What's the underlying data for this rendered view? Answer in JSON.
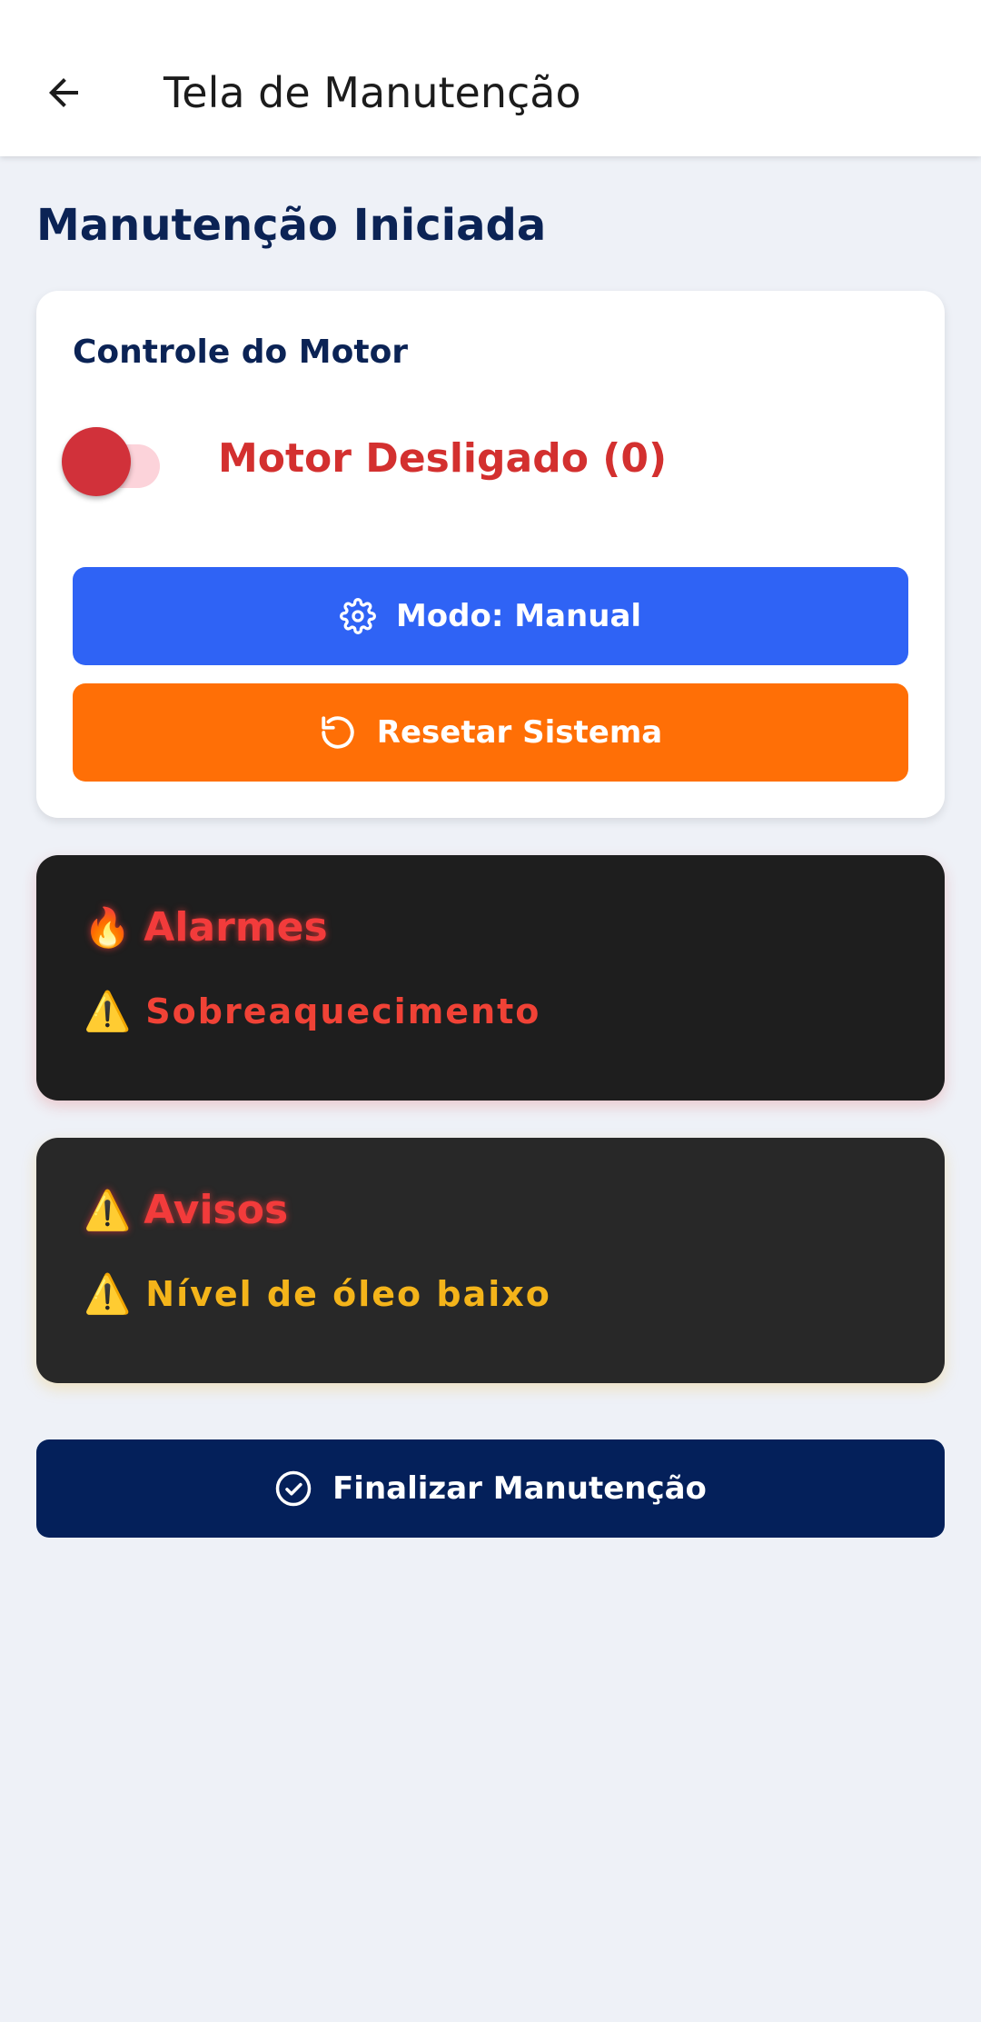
{
  "appbar": {
    "title": "Tela de Manutenção",
    "back_icon": "arrow-left-icon"
  },
  "page_title": "Manutenção Iniciada",
  "motor_card": {
    "title": "Controle do Motor",
    "toggle_on": false,
    "status_text": "Motor Desligado (0)",
    "status_color": "#d3302f",
    "mode_button": {
      "label": "Modo: Manual",
      "icon": "gear-icon",
      "color": "#2f63f5"
    },
    "reset_button": {
      "label": "Resetar Sistema",
      "icon": "refresh-icon",
      "color": "#ff6f06"
    }
  },
  "alarms": {
    "icon": "🔥",
    "title": "Alarmes",
    "items": [
      {
        "icon": "⚠️",
        "text": "Sobreaquecimento",
        "color": "#f04236"
      }
    ]
  },
  "warnings": {
    "icon": "⚠️",
    "title": "Avisos",
    "items": [
      {
        "icon": "⚠️",
        "text": "Nível de óleo baixo",
        "color": "#f4b41a"
      }
    ]
  },
  "finish_button": {
    "label": "Finalizar Manutenção",
    "icon": "check-circle-icon",
    "color": "#04205a"
  }
}
